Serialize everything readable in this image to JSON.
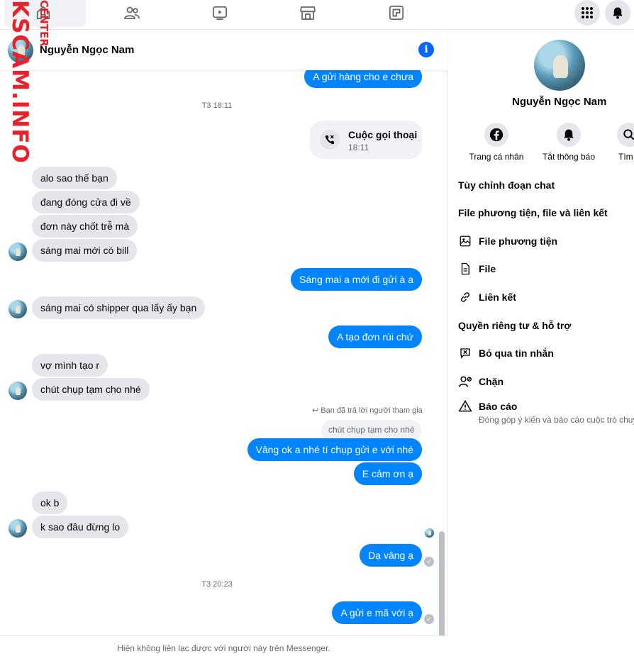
{
  "watermark": {
    "main": "KSCAM.INFO",
    "small": "CENTER"
  },
  "nav": {
    "icons": [
      "home-icon",
      "friends-icon",
      "watch-icon",
      "marketplace-icon",
      "gaming-icon"
    ],
    "right_icons": [
      "menu-grid-icon",
      "notifications-icon"
    ]
  },
  "chat": {
    "contact_name": "Nguyễn Ngọc Nam",
    "timestamp_1": "T3 18:11",
    "timestamp_2": "T3 20:23",
    "call": {
      "title": "Cuộc gọi thoại",
      "time": "18:11"
    },
    "reply": {
      "label": "Bạn đã trả lời người tham gia",
      "quoted": "chút chụp tạm cho nhé"
    },
    "messages": [
      {
        "side": "out",
        "text": "A gửi hàng cho e chưa"
      },
      {
        "side": "in",
        "text": "alo sao thế bạn"
      },
      {
        "side": "in",
        "text": "đang đóng cửa đi về"
      },
      {
        "side": "in",
        "text": "đơn này chốt trễ mà"
      },
      {
        "side": "in",
        "text": "sáng mai mới có bill"
      },
      {
        "side": "out",
        "text": "Sáng mai a mới đi gửi à a"
      },
      {
        "side": "in",
        "text": "sáng mai có shipper qua lấy ấy bạn"
      },
      {
        "side": "out",
        "text": "A tạo đơn rùi chứ"
      },
      {
        "side": "in",
        "text": "vợ mình tạo r"
      },
      {
        "side": "in",
        "text": "chút chụp tạm cho nhé"
      },
      {
        "side": "out",
        "text": "Vâng ok a nhé tí chụp gửi e với nhé"
      },
      {
        "side": "out",
        "text": "E cảm ơn ạ"
      },
      {
        "side": "in",
        "text": "ok b"
      },
      {
        "side": "in",
        "text": "k sao đâu đừng lo"
      },
      {
        "side": "out",
        "text": "Dạ vâng ạ"
      },
      {
        "side": "out",
        "text": "A gửi e mã với ạ"
      }
    ],
    "footer_note": "Hiện không liên lạc được với người này trên Messenger."
  },
  "panel": {
    "name": "Nguyễn Ngọc Nam",
    "actions": [
      {
        "label": "Trang cá nhân",
        "icon": "facebook-icon"
      },
      {
        "label": "Tắt thông báo",
        "icon": "bell-icon"
      },
      {
        "label": "Tìm k",
        "icon": "search-icon"
      }
    ],
    "section_customize": "Tùy chỉnh đoạn chat",
    "section_media": "File phương tiện, file và liên kết",
    "item_media": "File phương tiện",
    "item_file": "File",
    "item_links": "Liên kết",
    "section_privacy": "Quyền riêng tư & hỗ trợ",
    "item_ignore": "Bỏ qua tin nhắn",
    "item_block": "Chặn",
    "item_report": "Báo cáo",
    "item_report_sub": "Đóng góp ý kiến và báo cáo cuộc trò chuyện"
  },
  "colors": {
    "accent": "#0084ff",
    "incoming": "#e4e6eb",
    "watermark": "#e8222b"
  }
}
